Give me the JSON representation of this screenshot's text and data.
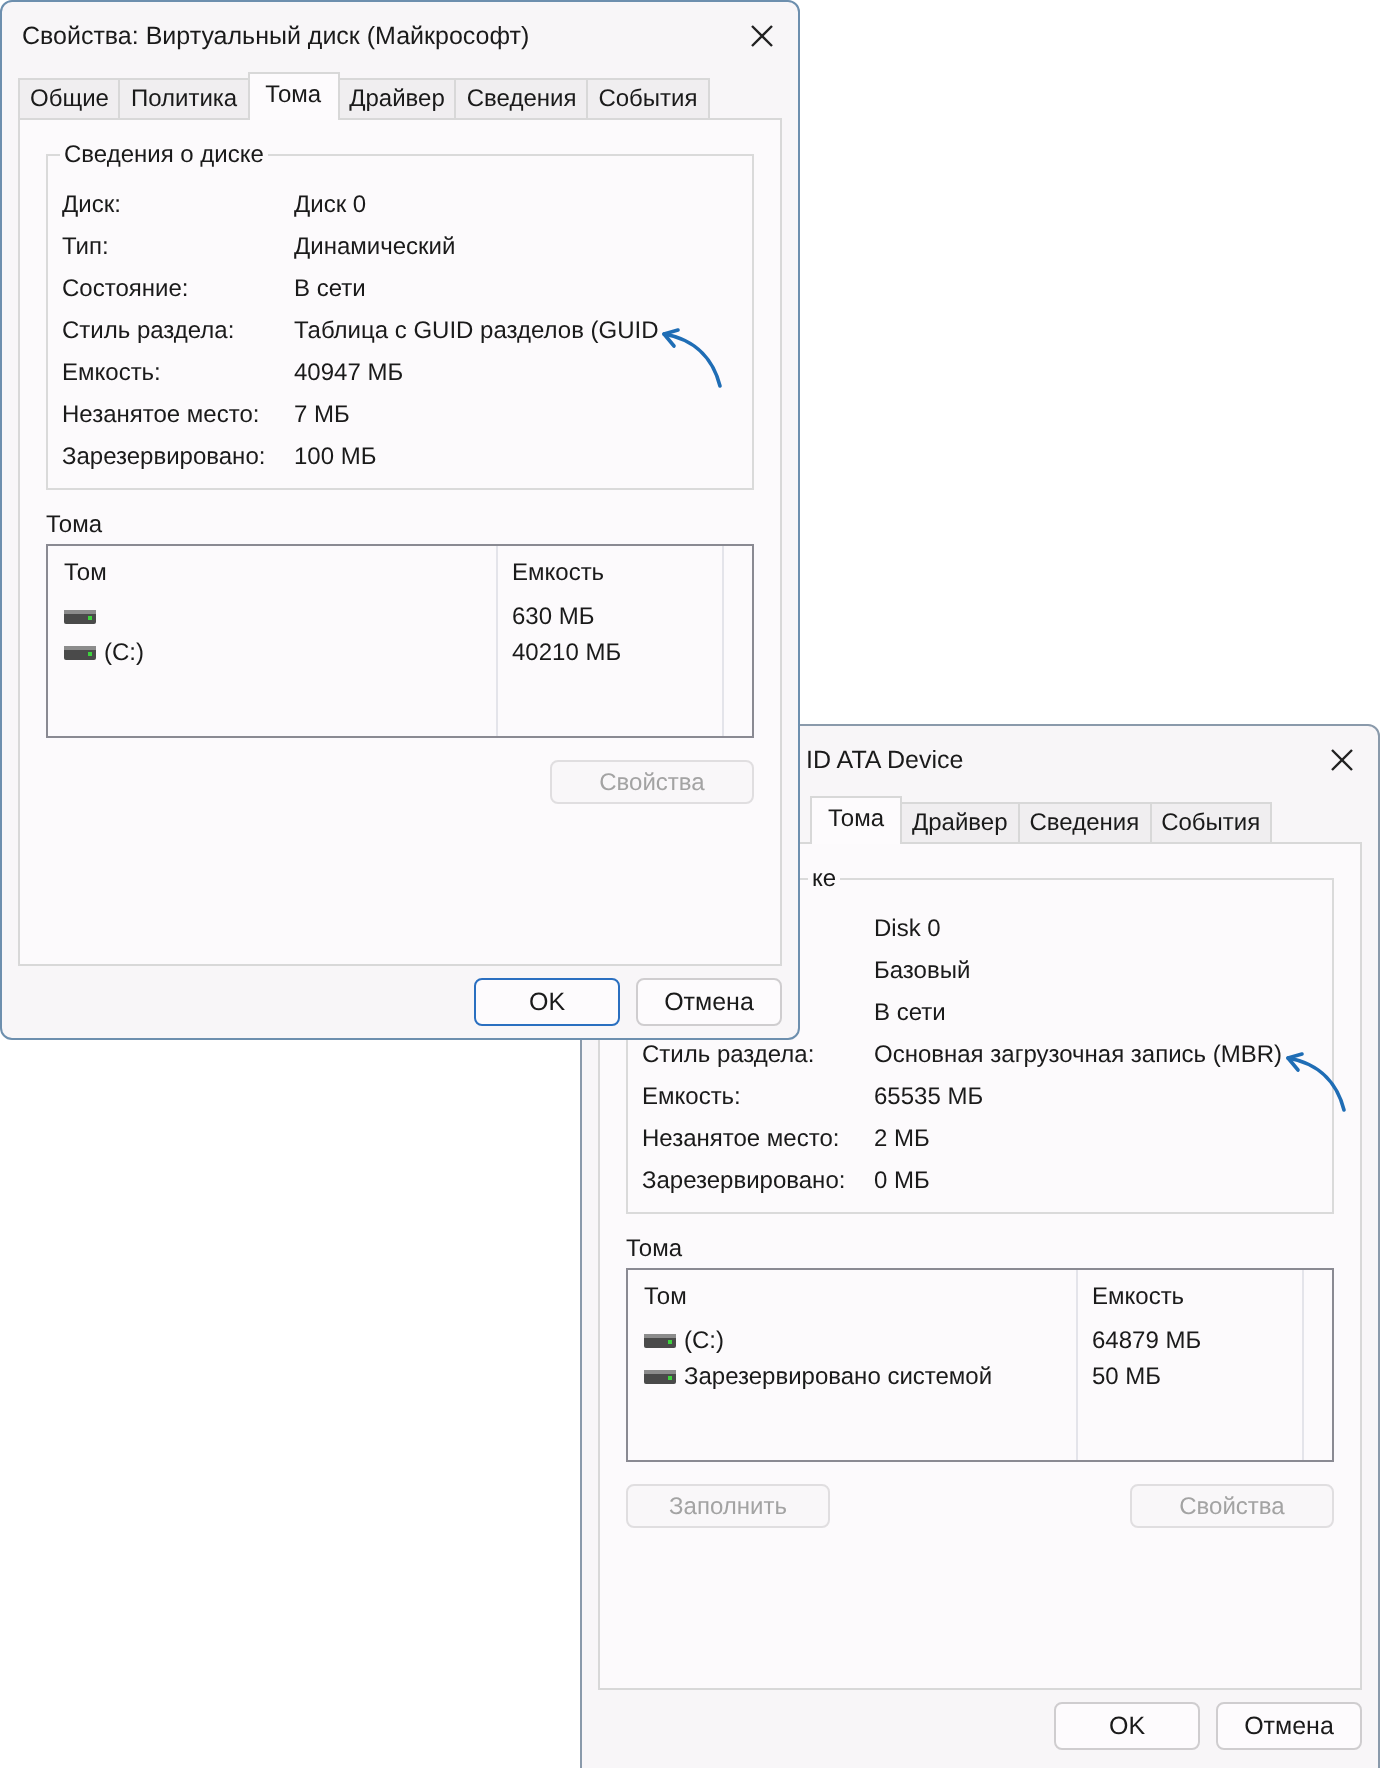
{
  "windows": [
    {
      "title": "Свойства: Виртуальный диск (Майкрософт)",
      "tabs": [
        {
          "label": "Общие",
          "selected": false
        },
        {
          "label": "Политика",
          "selected": false
        },
        {
          "label": "Тома",
          "selected": true
        },
        {
          "label": "Драйвер",
          "selected": false
        },
        {
          "label": "Сведения",
          "selected": false
        },
        {
          "label": "События",
          "selected": false
        }
      ],
      "disk_info": {
        "title": "Сведения о диске",
        "rows": [
          {
            "label": "Диск:",
            "value": "Диск 0",
            "annotated": false
          },
          {
            "label": "Тип:",
            "value": "Динамический",
            "annotated": false
          },
          {
            "label": "Состояние:",
            "value": "В сети",
            "annotated": false
          },
          {
            "label": "Стиль раздела:",
            "value": "Таблица с GUID разделов (GUID",
            "annotated": true
          },
          {
            "label": "Емкость:",
            "value": "40947 МБ",
            "annotated": false
          },
          {
            "label": "Незанятое место:",
            "value": "7 МБ",
            "annotated": false
          },
          {
            "label": "Зарезервировано:",
            "value": "100 МБ",
            "annotated": false
          }
        ]
      },
      "volumes": {
        "title": "Тома",
        "columns": [
          "Том",
          "Емкость"
        ],
        "rows": [
          {
            "capacity": "630 МБ"
          },
          {
            "name": "(C:)",
            "capacity": "40210 МБ"
          }
        ]
      },
      "buttons": [
        {
          "label": "Свойства",
          "disabled": true,
          "kind": "right"
        }
      ],
      "dialog_buttons": [
        {
          "label": "OK",
          "default": true
        },
        {
          "label": "Отмена",
          "default": false
        }
      ]
    },
    {
      "title": "ID ATA Device",
      "tabs": [
        {
          "label": "Тома",
          "selected": true
        },
        {
          "label": "Драйвер",
          "selected": false
        },
        {
          "label": "Сведения",
          "selected": false
        },
        {
          "label": "События",
          "selected": false
        }
      ],
      "disk_info": {
        "title": "ке",
        "rows": [
          {
            "value": "Disk 0",
            "annotated": false
          },
          {
            "value": "Базовый",
            "annotated": false
          },
          {
            "value": "В сети",
            "annotated": false
          },
          {
            "label": "Стиль раздела:",
            "value": "Основная загрузочная запись (MBR)",
            "annotated": true
          },
          {
            "label": "Емкость:",
            "value": "65535 МБ",
            "annotated": false
          },
          {
            "label": "Незанятое место:",
            "value": "2 МБ",
            "annotated": false
          },
          {
            "label": "Зарезервировано:",
            "value": "0 МБ",
            "annotated": false
          }
        ]
      },
      "volumes": {
        "title": "Тома",
        "columns": [
          "Том",
          "Емкость"
        ],
        "rows": [
          {
            "name": "(C:)",
            "capacity": "64879 МБ"
          },
          {
            "name": "Зарезервировано системой",
            "capacity": "50 МБ"
          }
        ]
      },
      "buttons": [
        {
          "label": "Заполнить",
          "disabled": true,
          "kind": "left"
        },
        {
          "label": "Свойства",
          "disabled": true,
          "kind": "right"
        }
      ],
      "dialog_buttons": [
        {
          "label": "OK",
          "default": false
        },
        {
          "label": "Отмена",
          "default": false
        }
      ]
    }
  ]
}
